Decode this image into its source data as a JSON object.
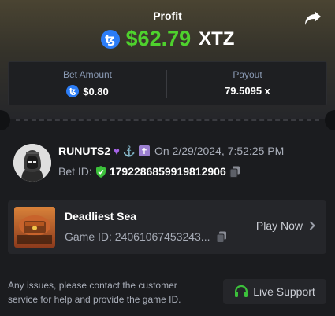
{
  "header": {
    "profit_label": "Profit",
    "currency_icon": "tezos-icon",
    "profit_value": "$62.79",
    "profit_unit": "XTZ",
    "share_icon": "share-icon"
  },
  "stats": {
    "bet_amount_label": "Bet Amount",
    "bet_amount_value": "$0.80",
    "payout_label": "Payout",
    "payout_value": "79.5095 x"
  },
  "user": {
    "name": "RUNUTS2",
    "badges": [
      "purple-heart-icon",
      "anchor-icon",
      "cross-icon"
    ],
    "timestamp": "On 2/29/2024, 7:52:25 PM",
    "bet_id_label": "Bet ID:",
    "bet_id": "1792286859919812906"
  },
  "game": {
    "name": "Deadliest Sea",
    "thumbnail_text": "DEADLIEST SEA",
    "game_id": "Game ID: 24061067453243...",
    "play_label": "Play Now"
  },
  "footer": {
    "message": "Any issues, please contact the customer service for help and provide the game ID.",
    "support_label": "Live Support"
  },
  "colors": {
    "profit_green": "#4ed12d",
    "tezos_blue": "#2c7df7",
    "verified_green": "#3cc13b"
  }
}
